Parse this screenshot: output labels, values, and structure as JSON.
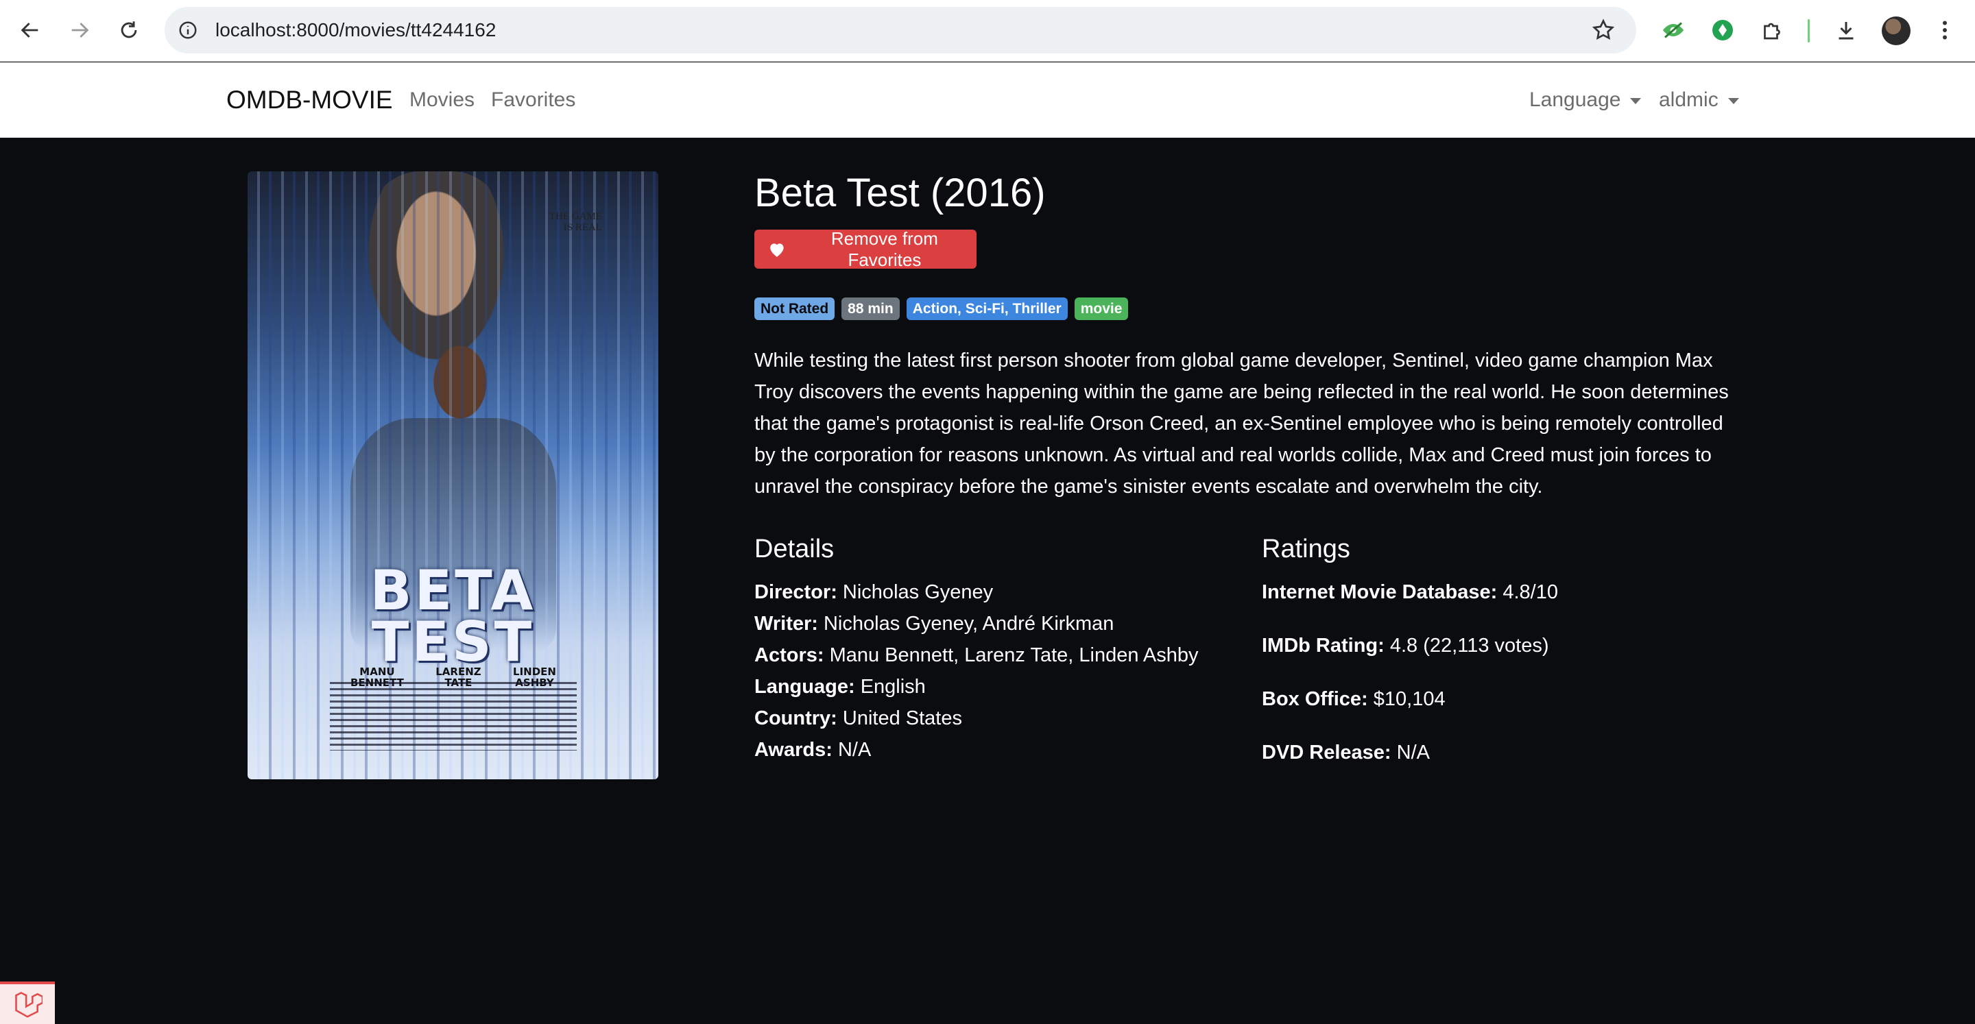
{
  "browser": {
    "url": "localhost:8000/movies/tt4244162",
    "back_icon": "arrow-left-icon",
    "forward_icon": "arrow-right-icon",
    "reload_icon": "reload-icon",
    "bookmark_icon": "star-icon"
  },
  "nav": {
    "brand": "OMDB-MOVIE",
    "links": [
      "Movies",
      "Favorites"
    ],
    "language": "Language",
    "user": "aldmic"
  },
  "movie": {
    "title": "Beta Test (2016)",
    "favorite_button": "Remove from Favorites",
    "badges": [
      {
        "text": "Not Rated",
        "color": "#6ea8e6",
        "text_color": "#0b0c10"
      },
      {
        "text": "88 min",
        "color": "#6c757d",
        "text_color": "#ffffff"
      },
      {
        "text": "Action, Sci-Fi, Thriller",
        "color": "#3d86e0",
        "text_color": "#ffffff"
      },
      {
        "text": "movie",
        "color": "#4bb35a",
        "text_color": "#ffffff"
      }
    ],
    "plot": "While testing the latest first person shooter from global game developer, Sentinel, video game champion Max Troy discovers the events happening within the game are being reflected in the real world. He soon determines that the game's protagonist is real-life Orson Creed, an ex-Sentinel employee who is being remotely controlled by the corporation for reasons unknown. As virtual and real worlds collide, Max and Creed must join forces to unravel the conspiracy before the game's sinister events escalate and overwhelm the city.",
    "details_heading": "Details",
    "details": [
      {
        "label": "Director:",
        "value": "Nicholas Gyeney"
      },
      {
        "label": "Writer:",
        "value": "Nicholas Gyeney, André Kirkman"
      },
      {
        "label": "Actors:",
        "value": "Manu Bennett, Larenz Tate, Linden Ashby"
      },
      {
        "label": "Language:",
        "value": "English"
      },
      {
        "label": "Country:",
        "value": "United States"
      },
      {
        "label": "Awards:",
        "value": "N/A"
      }
    ],
    "ratings_heading": "Ratings",
    "ratings": [
      {
        "label": "Internet Movie Database:",
        "value": "4.8/10"
      },
      {
        "label": "IMDb Rating:",
        "value": "4.8 (22,113 votes)"
      },
      {
        "label": "Box Office:",
        "value": "$10,104"
      },
      {
        "label": "DVD Release:",
        "value": "N/A"
      }
    ]
  },
  "poster": {
    "tagline_1": "THE GAME",
    "tagline_2": "IS REAL",
    "title_1": "BETA",
    "title_2": "TEST",
    "cast": [
      {
        "first": "MANU",
        "last": "BENNETT"
      },
      {
        "first": "LARENZ",
        "last": "TATE"
      },
      {
        "first": "LINDEN",
        "last": "ASHBY"
      }
    ]
  }
}
